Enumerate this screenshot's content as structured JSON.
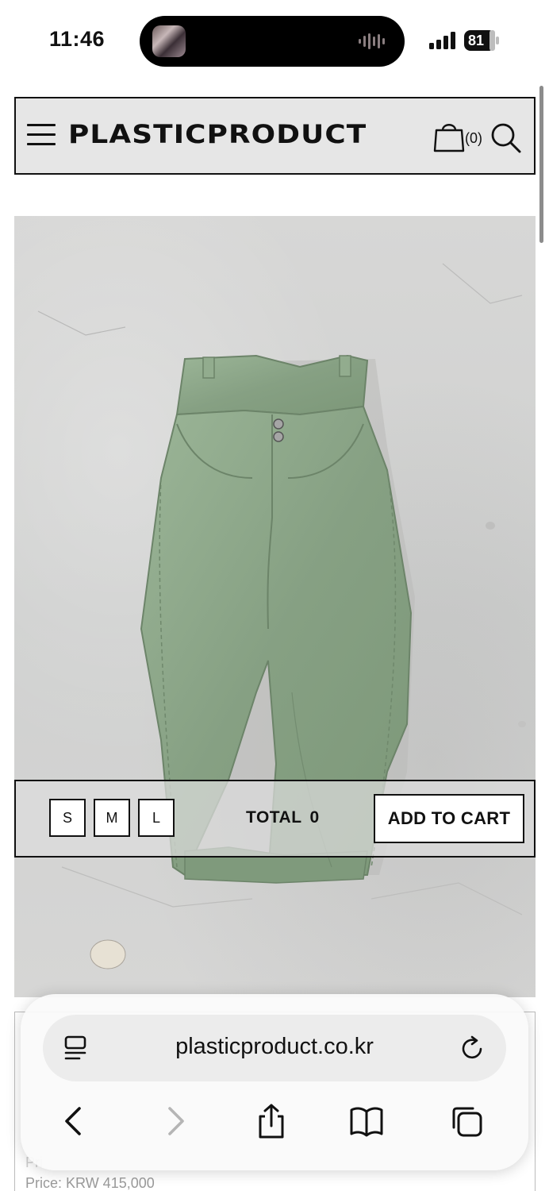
{
  "status_bar": {
    "time": "11:46",
    "battery": "81"
  },
  "header": {
    "logo": "PLASTICPRODUCT",
    "cart_count": "(0)"
  },
  "product": {
    "image_desc_icon": "green-jeans-image",
    "price_line": "Price: KRW 415,000",
    "price_line_faint": "Pri"
  },
  "purchase_bar": {
    "sizes": [
      "S",
      "M",
      "L"
    ],
    "total_label": "TOTAL",
    "total_value": "0",
    "add_to_cart": "ADD TO CART"
  },
  "browser": {
    "url": "plasticproduct.co.kr"
  },
  "colors": {
    "header_bg": "#e6e6e6",
    "denim_green": "#8fa98c",
    "border": "#111111"
  }
}
